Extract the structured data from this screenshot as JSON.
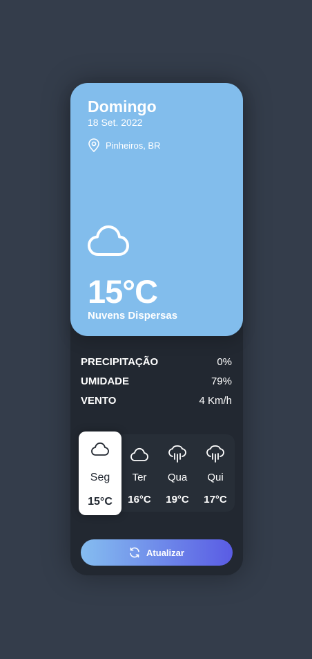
{
  "hero": {
    "day": "Domingo",
    "date": "18 Set. 2022",
    "location": "Pinheiros, BR",
    "location_icon": "map-pin-icon",
    "weather_icon": "cloud-icon",
    "temperature": "15°C",
    "description": "Nuvens Dispersas"
  },
  "stats": [
    {
      "label": "PRECIPITAÇÃO",
      "value": "0%"
    },
    {
      "label": "UMIDADE",
      "value": "79%"
    },
    {
      "label": "VENTO",
      "value": "4 Km/h"
    }
  ],
  "week": [
    {
      "day": "Seg",
      "temp": "15°C",
      "icon": "cloud-icon",
      "active": true
    },
    {
      "day": "Ter",
      "temp": "16°C",
      "icon": "cloud-icon",
      "active": false
    },
    {
      "day": "Qua",
      "temp": "19°C",
      "icon": "cloud-rain-icon",
      "active": false
    },
    {
      "day": "Qui",
      "temp": "17°C",
      "icon": "cloud-rain-icon",
      "active": false
    }
  ],
  "button": {
    "label": "Atualizar",
    "icon": "refresh-icon"
  },
  "colors": {
    "background": "#343d4b",
    "card": "#222831",
    "hero": "#82bdec",
    "button_gradient_start": "#85bdf0",
    "button_gradient_end": "#5a5ce4"
  }
}
